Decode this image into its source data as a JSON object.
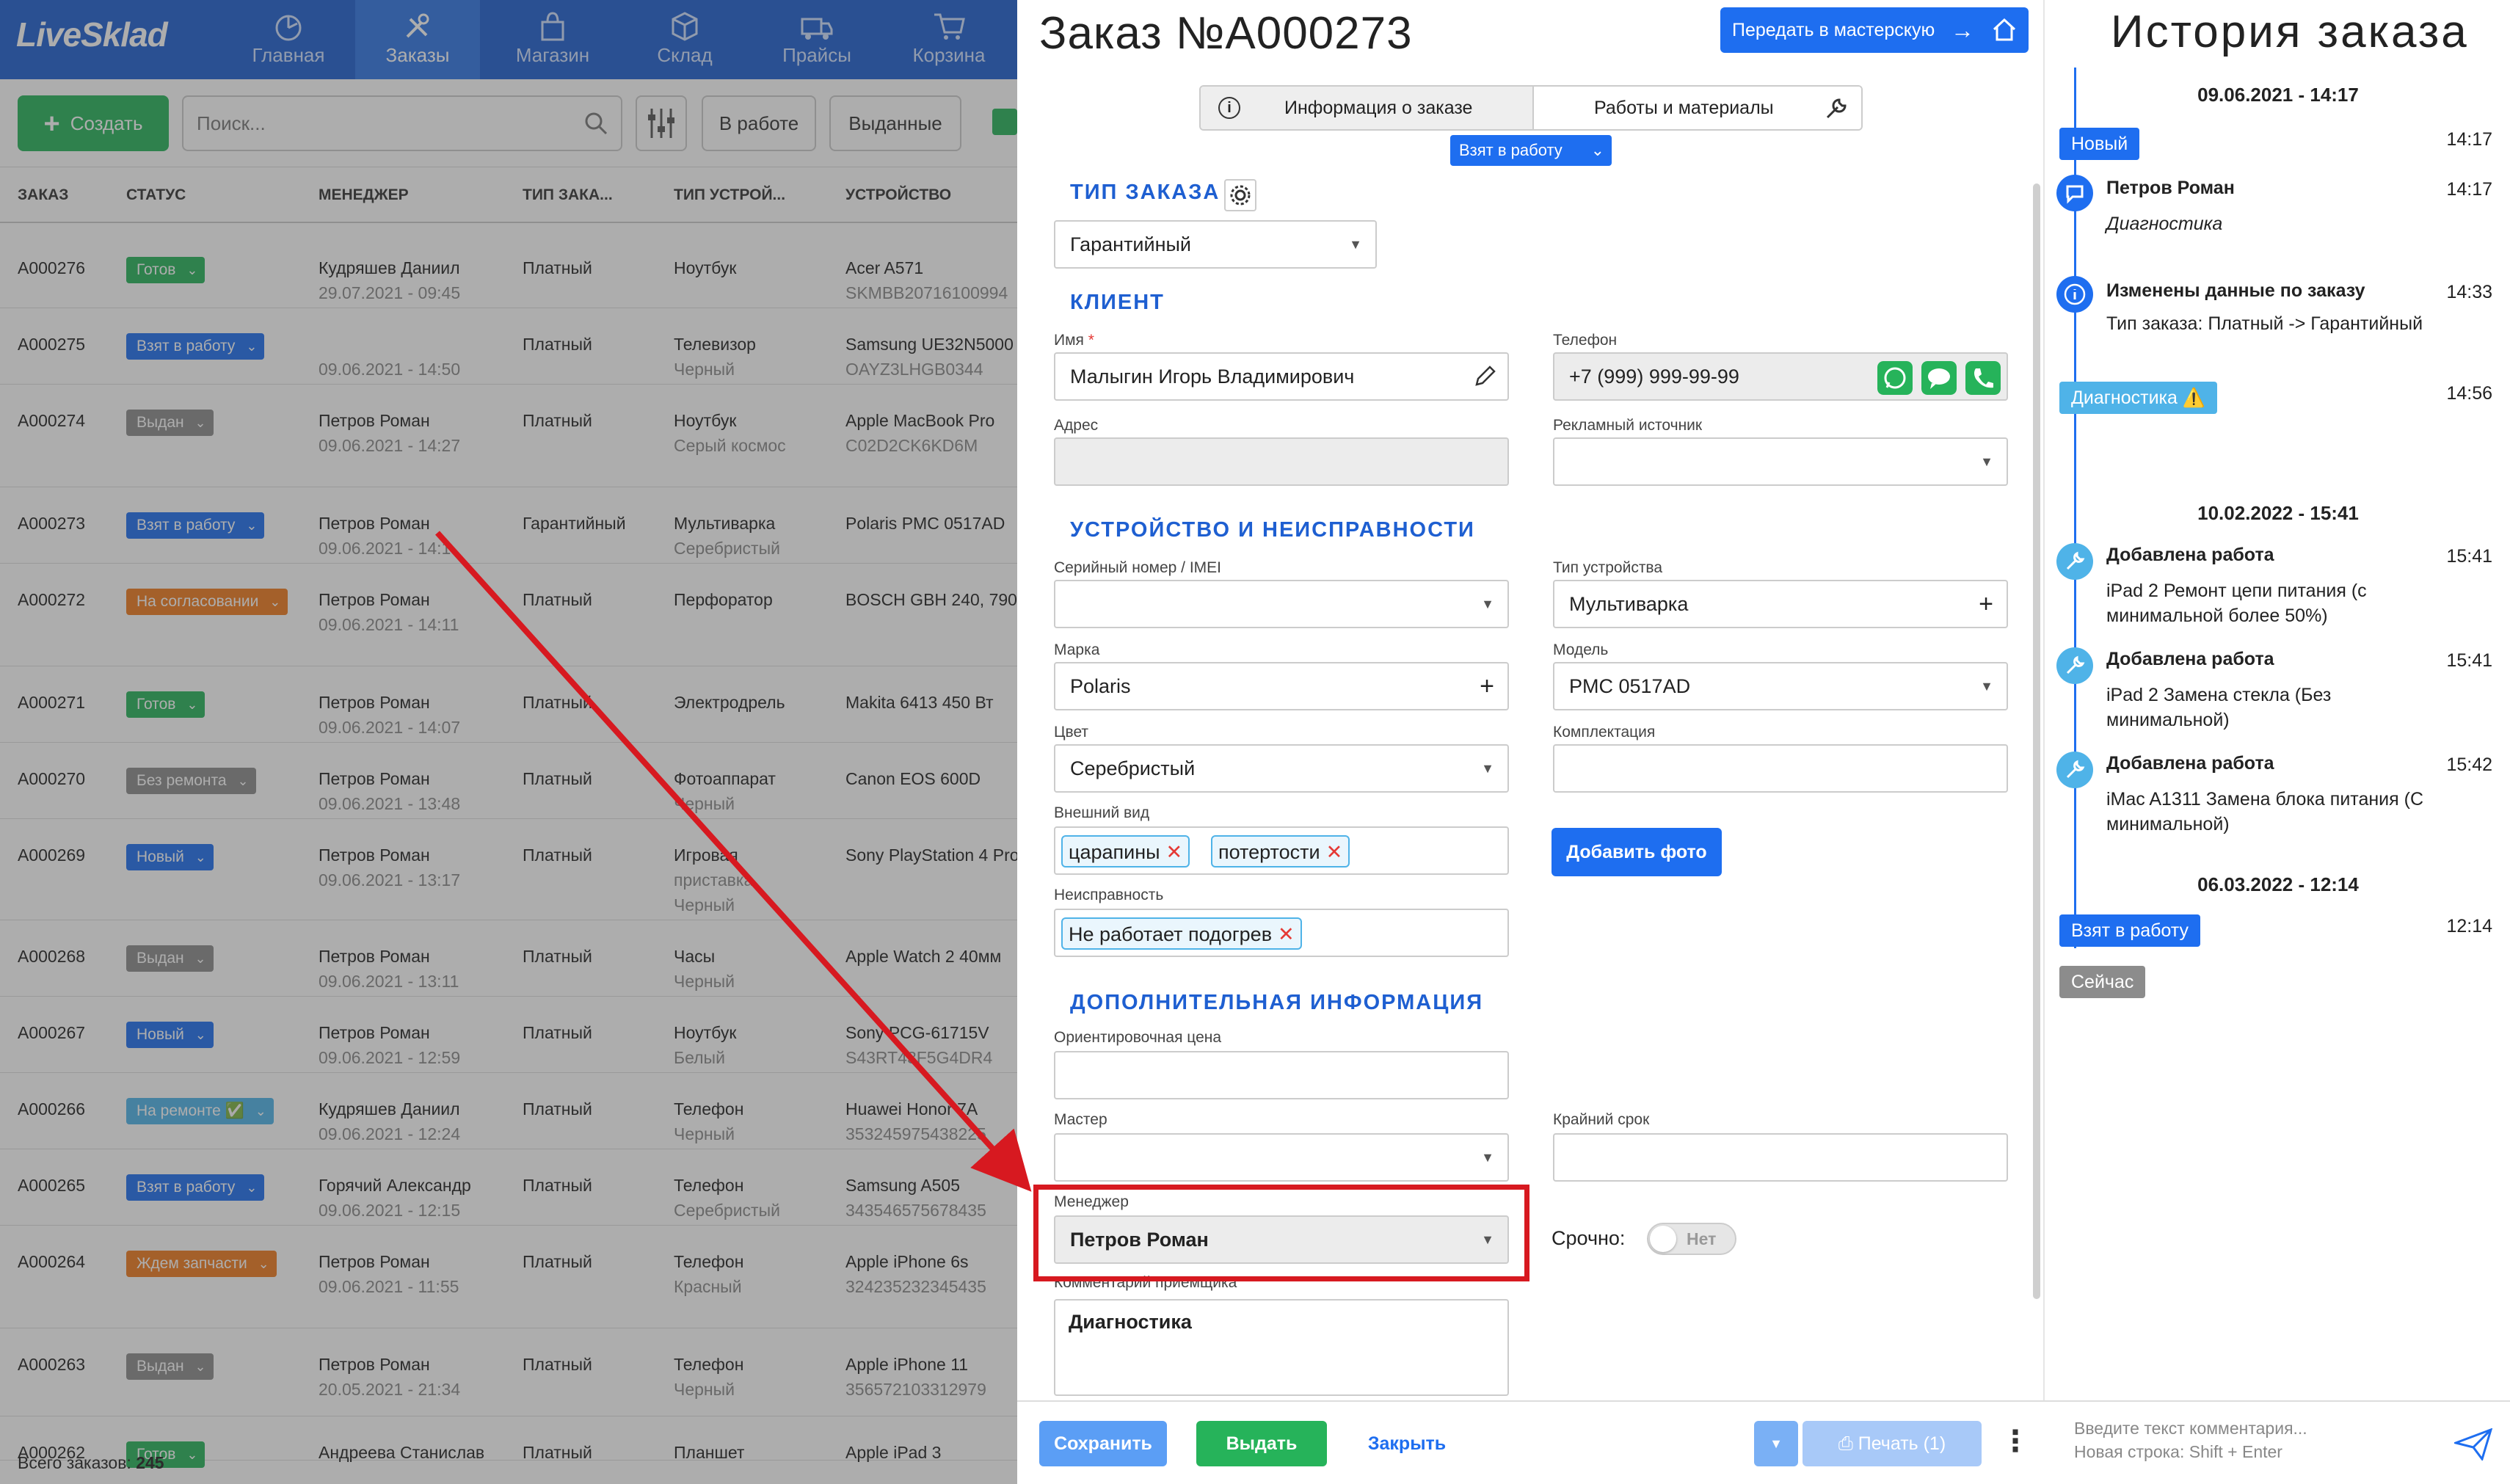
{
  "app": {
    "logo": "LiveSklad",
    "nav": [
      {
        "label": "Главная",
        "icon": "dashboard-icon"
      },
      {
        "label": "Заказы",
        "icon": "tools-icon",
        "active": true
      },
      {
        "label": "Магазин",
        "icon": "bag-icon"
      },
      {
        "label": "Склад",
        "icon": "box-icon"
      },
      {
        "label": "Прайсы",
        "icon": "truck-icon"
      },
      {
        "label": "Корзина",
        "icon": "cart-icon"
      }
    ],
    "toolbar": {
      "create_label": "Создать",
      "search_placeholder": "Поиск...",
      "filter_buttons": [
        "В работе",
        "Выданные"
      ]
    },
    "table_headers": [
      "ЗАКАЗ",
      "СТАТУС",
      "МЕНЕДЖЕР",
      "ТИП ЗАКА...",
      "ТИП УСТРОЙ...",
      "УСТРОЙСТВО"
    ],
    "rows": [
      {
        "id": "A000276",
        "status": "Готов",
        "status_color": "#26b35a",
        "manager": "Кудряшев Даниил",
        "date": "29.07.2021 - 09:45",
        "type": "Платный",
        "device_type": "Ноутбук",
        "device_type2": "",
        "device": "Acer A571",
        "device2": "SKMBB20716100994"
      },
      {
        "id": "A000275",
        "status": "Взят в работу",
        "status_color": "#1e6ef0",
        "manager": "",
        "date": "09.06.2021 - 14:50",
        "type": "Платный",
        "device_type": "Телевизор",
        "device_type2": "Черный",
        "device": "Samsung UE32N5000",
        "device2": "OAYZ3LHGB0344"
      },
      {
        "id": "A000274",
        "status": "Выдан",
        "status_color": "#8c8c8c",
        "manager": "Петров Роман",
        "date": "09.06.2021 - 14:27",
        "type": "Платный",
        "device_type": "Ноутбук",
        "device_type2": "Серый космос",
        "device": "Apple MacBook Pro",
        "device2": "C02D2CK6KD6M"
      },
      {
        "id": "A000273",
        "status": "Взят в работу",
        "status_color": "#1e6ef0",
        "manager": "Петров Роман",
        "date": "09.06.2021 - 14:1",
        "type": "Гарантийный",
        "device_type": "Мультиварка",
        "device_type2": "Серебристый",
        "device": "Polaris PMC 0517AD",
        "device2": ""
      },
      {
        "id": "A000272",
        "status": "На согласовании",
        "status_color": "#f07a1e",
        "manager": "Петров Роман",
        "date": "09.06.2021 - 14:11",
        "type": "Платный",
        "device_type": "Перфоратор",
        "device_type2": "",
        "device": "BOSCH GBH 240, 790",
        "device2": ""
      },
      {
        "id": "A000271",
        "status": "Готов",
        "status_color": "#26b35a",
        "manager": "Петров Роман",
        "date": "09.06.2021 - 14:07",
        "type": "Платный",
        "device_type": "Электродрель",
        "device_type2": "",
        "device": "Makita 6413 450 Вт",
        "device2": ""
      },
      {
        "id": "A000270",
        "status": "Без ремонта",
        "status_color": "#8c8c8c",
        "manager": "Петров Роман",
        "date": "09.06.2021 - 13:48",
        "type": "Платный",
        "device_type": "Фотоаппарат",
        "device_type2": "Черный",
        "device": "Canon EOS 600D",
        "device2": ""
      },
      {
        "id": "A000269",
        "status": "Новый",
        "status_color": "#1e6ef0",
        "manager": "Петров Роман",
        "date": "09.06.2021 - 13:17",
        "type": "Платный",
        "device_type": "Игровая",
        "device_type2": "приставка",
        "device_type3": "Черный",
        "device": "Sony PlayStation 4 Pro",
        "device2": ""
      },
      {
        "id": "A000268",
        "status": "Выдан",
        "status_color": "#8c8c8c",
        "manager": "Петров Роман",
        "date": "09.06.2021 - 13:11",
        "type": "Платный",
        "device_type": "Часы",
        "device_type2": "Черный",
        "device": "Apple Watch 2 40мм",
        "device2": ""
      },
      {
        "id": "A000267",
        "status": "Новый",
        "status_color": "#1e6ef0",
        "manager": "Петров Роман",
        "date": "09.06.2021 - 12:59",
        "type": "Платный",
        "device_type": "Ноутбук",
        "device_type2": "Белый",
        "device": "Sony PCG-61715V",
        "device2": "S43RT43F5G4DR4"
      },
      {
        "id": "A000266",
        "status": "На ремонте ✅",
        "status_color": "#4fb3e8",
        "manager": "Кудряшев Даниил",
        "date": "09.06.2021 - 12:24",
        "type": "Платный",
        "device_type": "Телефон",
        "device_type2": "Черный",
        "device": "Huawei Honor 7A",
        "device2": "353245975438225"
      },
      {
        "id": "A000265",
        "status": "Взят в работу",
        "status_color": "#1e6ef0",
        "manager": "Горячий Александр",
        "date": "09.06.2021 - 12:15",
        "type": "Платный",
        "device_type": "Телефон",
        "device_type2": "Серебристый",
        "device": "Samsung A505",
        "device2": "343546575678435"
      },
      {
        "id": "A000264",
        "status": "Ждем запчасти",
        "status_color": "#f07a1e",
        "manager": "Петров Роман",
        "date": "09.06.2021 - 11:55",
        "type": "Платный",
        "device_type": "Телефон",
        "device_type2": "Красный",
        "device": "Apple iPhone 6s",
        "device2": "324235232345435"
      },
      {
        "id": "A000263",
        "status": "Выдан",
        "status_color": "#8c8c8c",
        "manager": "Петров Роман",
        "date": "20.05.2021 - 21:34",
        "type": "Платный",
        "device_type": "Телефон",
        "device_type2": "Черный",
        "device": "Apple iPhone 11",
        "device2": "356572103312979"
      },
      {
        "id": "A000262",
        "status": "Готов",
        "status_color": "#26b35a",
        "manager": "Андреева Станислав",
        "date": "",
        "type": "Платный",
        "device_type": "Планшет",
        "device_type2": "",
        "device": "Apple iPad 3",
        "device2": ""
      }
    ],
    "total_label": "Всего заказов:",
    "total_value": "245"
  },
  "order": {
    "title": "Заказ №A000273",
    "transfer_label": "Передать в мастерскую",
    "tab_info": "Информация о заказе",
    "tab_works": "Работы и материалы",
    "status": "Взят в работу",
    "sections": {
      "order_type": "ТИП ЗАКАЗА",
      "client": "КЛИЕНТ",
      "device": "УСТРОЙСТВО И НЕИСПРАВНОСТИ",
      "extra": "ДОПОЛНИТЕЛЬНАЯ ИНФОРМАЦИЯ"
    },
    "order_type_value": "Гарантийный",
    "labels": {
      "name": "Имя",
      "phone": "Телефон",
      "address": "Адрес",
      "ad_source": "Рекламный источник",
      "serial": "Серийный номер / IMEI",
      "device_type": "Тип устройства",
      "brand": "Марка",
      "model": "Модель",
      "color": "Цвет",
      "kit": "Комплектация",
      "appearance": "Внешний вид",
      "fault": "Неисправность",
      "price": "Ориентировочная цена",
      "master": "Мастер",
      "deadline": "Крайний срок",
      "manager": "Менеджер",
      "urgent": "Срочно:",
      "comment": "Комментарий приемщика"
    },
    "values": {
      "name": "Малыгин Игорь Владимирович",
      "phone": "+7 (999) 999-99-99",
      "device_type": "Мультиварка",
      "brand": "Polaris",
      "model": "PMC 0517AD",
      "color": "Серебристый",
      "appearance_tags": [
        "царапины",
        "потертости"
      ],
      "fault_tags": [
        "Не работает подогрев"
      ],
      "manager": "Петров Роман",
      "urgent": "Нет",
      "comment": "Диагностика"
    },
    "add_photo": "Добавить фото",
    "buttons": {
      "save": "Сохранить",
      "issue": "Выдать",
      "close": "Закрыть",
      "print": "Печать (1)"
    }
  },
  "history": {
    "title": "История заказа",
    "entries": [
      {
        "kind": "date",
        "text": "09.06.2021 - 14:17"
      },
      {
        "kind": "pill",
        "text": "Новый",
        "time": "14:17"
      },
      {
        "kind": "event",
        "title": "Петров Роман",
        "text": "Диагностика",
        "time": "14:17"
      },
      {
        "kind": "event",
        "title": "Изменены данные по заказу",
        "text": "Тип заказа: Платный -> Гарантийный",
        "time": "14:33"
      },
      {
        "kind": "pill",
        "text": "Диагностика ⚠️",
        "time": "14:56"
      },
      {
        "kind": "date",
        "text": "10.02.2022 - 15:41"
      },
      {
        "kind": "event",
        "title": "Добавлена работа",
        "text": "iPad 2 Ремонт цепи питания (с минимальной более 50%)",
        "time": "15:41"
      },
      {
        "kind": "event",
        "title": "Добавлена работа",
        "text": "iPad 2 Замена стекла (Без минимальной)",
        "time": "15:41"
      },
      {
        "kind": "event",
        "title": "Добавлена работа",
        "text": "iMac A1311 Замена блока питания (С минимальной)",
        "time": "15:42"
      },
      {
        "kind": "date",
        "text": "06.03.2022 - 12:14"
      },
      {
        "kind": "pill",
        "text": "Взят в работу",
        "time": "12:14"
      },
      {
        "kind": "pill",
        "text": "Сейчас",
        "time": ""
      }
    ],
    "comment_placeholder_1": "Введите текст комментария...",
    "comment_placeholder_2": "Новая строка: Shift + Enter"
  },
  "colors": {
    "primary": "#1e6ef0",
    "nav": "#1e5fd1",
    "success": "#26b35a",
    "highlight": "#d71920"
  }
}
